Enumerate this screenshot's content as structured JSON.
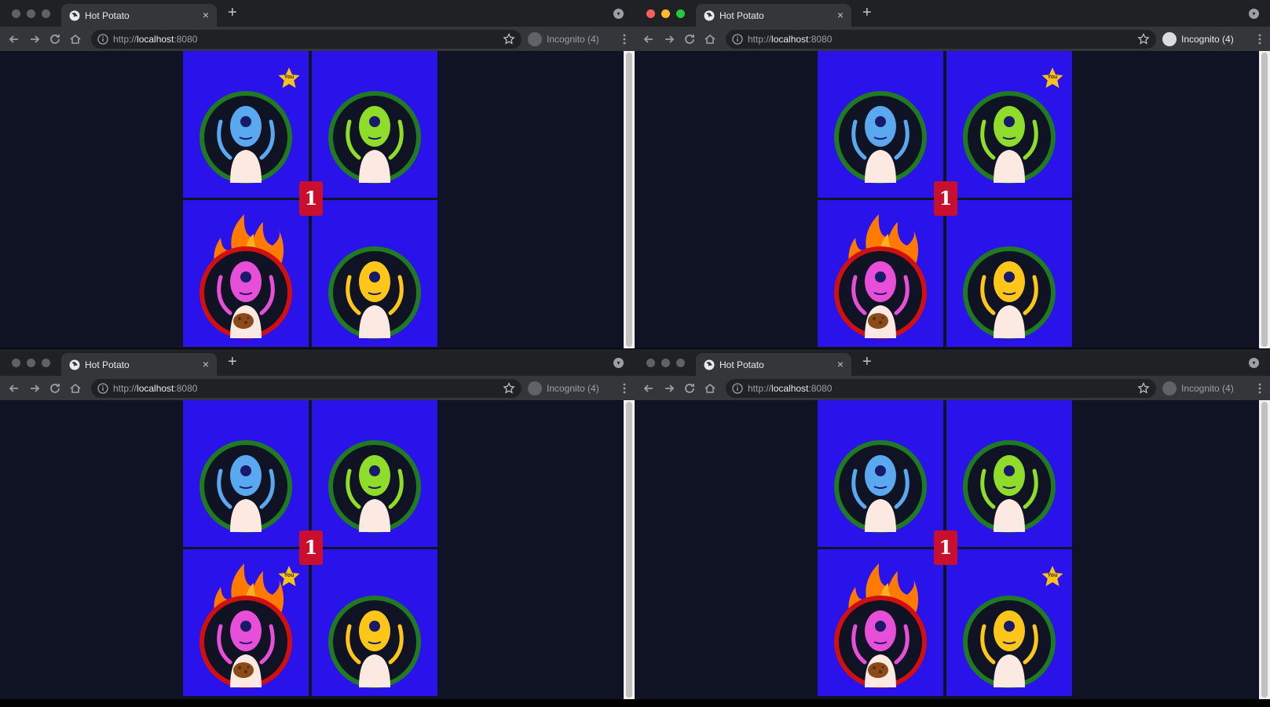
{
  "browser": {
    "tab_title": "Hot Potato",
    "url_scheme": "http://",
    "url_host": "localhost",
    "url_port": ":8080",
    "incognito_label": "Incognito (4)",
    "new_tab_glyph": "+",
    "close_tab_glyph": "×"
  },
  "game": {
    "counter": "1",
    "you_badge": "You"
  },
  "windows": [
    {
      "active": false,
      "you_player": 0
    },
    {
      "active": true,
      "you_player": 1
    },
    {
      "active": false,
      "you_player": 2
    },
    {
      "active": false,
      "you_player": 3
    }
  ],
  "players": [
    {
      "name": "blue-alien",
      "body_color": "#5aa9f0",
      "ring_color": "#1f7a22",
      "has_potato": false
    },
    {
      "name": "green-alien",
      "body_color": "#8fdc2a",
      "ring_color": "#1f7a22",
      "has_potato": false
    },
    {
      "name": "pink-alien",
      "body_color": "#e84fd8",
      "ring_color": "#d01010",
      "has_potato": true
    },
    {
      "name": "yellow-alien",
      "body_color": "#ffc61a",
      "ring_color": "#1f7a22",
      "has_potato": false
    }
  ],
  "colors": {
    "cell_background": "#2a13ea",
    "page_background": "#0f1323",
    "counter_background": "#c8102e",
    "star": "#f7c21a"
  },
  "icons": [
    "chrome-favicon",
    "close-icon",
    "new-tab-icon",
    "back-icon",
    "forward-icon",
    "reload-icon",
    "home-icon",
    "info-icon",
    "bookmark-star-icon",
    "incognito-icon",
    "menu-icon",
    "you-star-icon",
    "fire-icon",
    "potato-icon"
  ]
}
